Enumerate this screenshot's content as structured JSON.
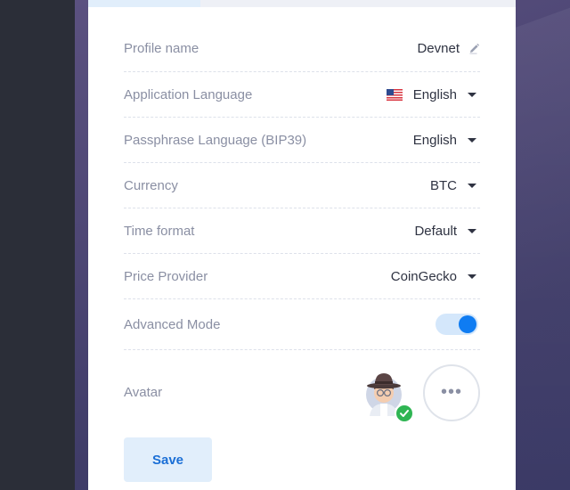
{
  "settings": {
    "rows": [
      {
        "label": "Profile name",
        "value": "Devnet"
      },
      {
        "label": "Application Language",
        "value": "English"
      },
      {
        "label": "Passphrase Language (BIP39)",
        "value": "English"
      },
      {
        "label": "Currency",
        "value": "BTC"
      },
      {
        "label": "Time format",
        "value": "Default"
      },
      {
        "label": "Price Provider",
        "value": "CoinGecko"
      }
    ],
    "advanced_mode": {
      "label": "Advanced Mode",
      "enabled": true
    },
    "avatar": {
      "label": "Avatar",
      "more_label": "•••"
    }
  },
  "actions": {
    "save_label": "Save"
  },
  "colors": {
    "accent": "#0f7cf2",
    "success": "#2fb553",
    "label": "#8a8fa3",
    "value": "#2f3342"
  },
  "icons": {
    "edit": "pencil-icon",
    "dropdown": "caret-down-icon",
    "flag": "us-flag-icon",
    "selected": "check-icon"
  }
}
